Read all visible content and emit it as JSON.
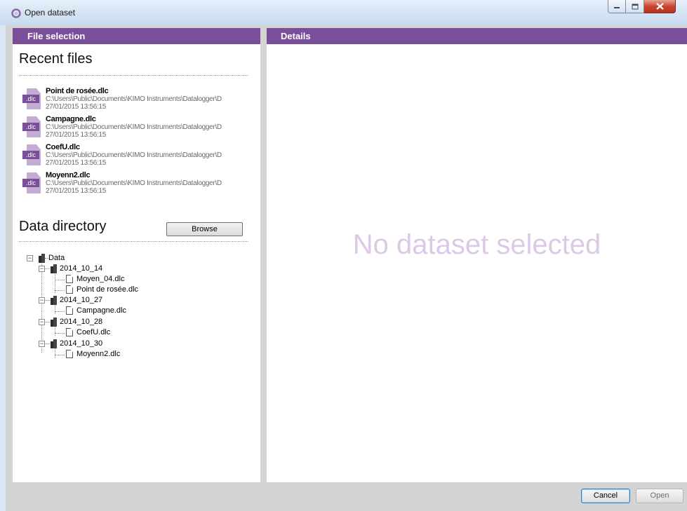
{
  "window": {
    "title": "Open dataset",
    "icon": "app-icon"
  },
  "left_panel": {
    "header": "File selection",
    "recent_title": "Recent files",
    "recent_files": [
      {
        "name": "Point de rosée.dlc",
        "path": "C:\\Users\\Public\\Documents\\KIMO Instruments\\Datalogger\\D",
        "date": "27/01/2015 13:56:15",
        "badge": ".dlc"
      },
      {
        "name": "Campagne.dlc",
        "path": "C:\\Users\\Public\\Documents\\KIMO Instruments\\Datalogger\\D",
        "date": "27/01/2015 13:56:15",
        "badge": ".dlc"
      },
      {
        "name": "CoefU.dlc",
        "path": "C:\\Users\\Public\\Documents\\KIMO Instruments\\Datalogger\\D",
        "date": "27/01/2015 13:56:15",
        "badge": ".dlc"
      },
      {
        "name": "Moyenn2.dlc",
        "path": "C:\\Users\\Public\\Documents\\KIMO Instruments\\Datalogger\\D",
        "date": "27/01/2015 13:56:15",
        "badge": ".dlc"
      }
    ],
    "directory_title": "Data directory",
    "browse_label": "Browse",
    "tree": {
      "root": "Data",
      "folders": [
        {
          "name": "2014_10_14",
          "files": [
            "Moyen_04.dlc",
            "Point de rosée.dlc"
          ]
        },
        {
          "name": "2014_10_27",
          "files": [
            "Campagne.dlc"
          ]
        },
        {
          "name": "2014_10_28",
          "files": [
            "CoefU.dlc"
          ]
        },
        {
          "name": "2014_10_30",
          "files": [
            "Moyenn2.dlc"
          ]
        }
      ],
      "expander_symbol": "−"
    }
  },
  "right_panel": {
    "header": "Details",
    "empty_message": "No dataset selected"
  },
  "footer": {
    "cancel_label": "Cancel",
    "open_label": "Open"
  },
  "colors": {
    "accent": "#7b4e9a",
    "empty_text": "#dcc8e7"
  }
}
